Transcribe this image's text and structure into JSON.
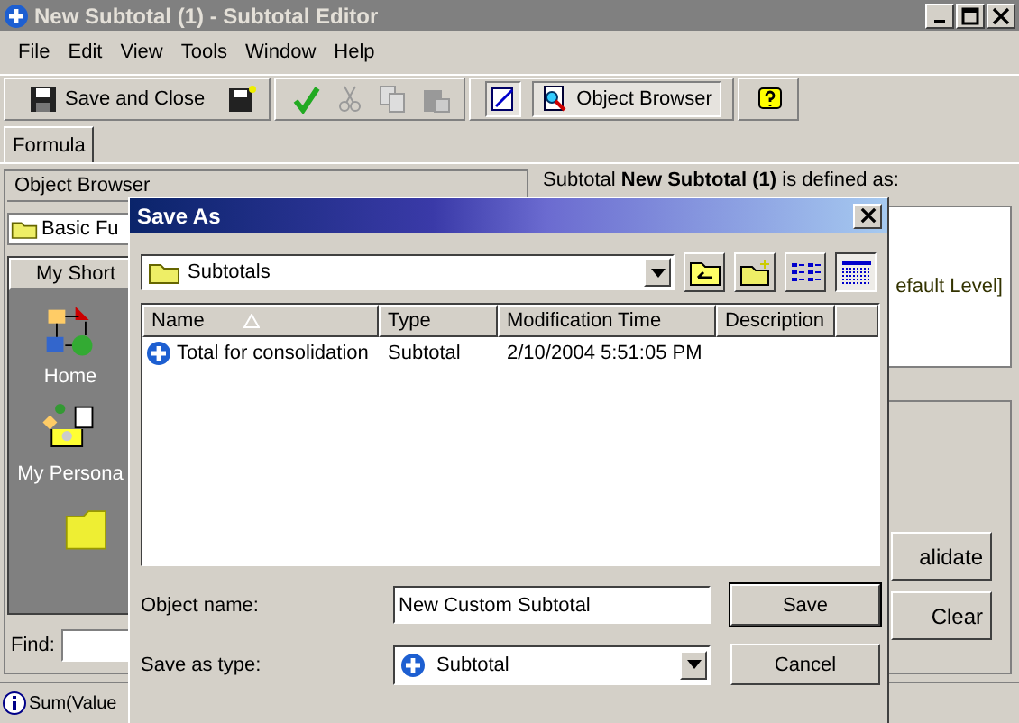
{
  "window": {
    "title": "New Subtotal (1) - Subtotal Editor"
  },
  "menu": [
    "File",
    "Edit",
    "View",
    "Tools",
    "Window",
    "Help"
  ],
  "toolbar": {
    "save_close": "Save and Close",
    "object_browser": {
      "label": "Object Browser",
      "selected": true
    }
  },
  "tabs": [
    {
      "label": "Formula",
      "selected": true
    }
  ],
  "left_panel": {
    "dropdown": "Object Browser",
    "category": "Basic Fu",
    "shortcuts_header": "My Short",
    "shortcuts": [
      {
        "kind": "home",
        "label": "Home"
      },
      {
        "kind": "personal",
        "label": "My Persona"
      },
      {
        "kind": "folder"
      }
    ],
    "find_label": "Find:"
  },
  "right_panel": {
    "definition": "Subtotal **New Subtotal (1)** is defined as:",
    "formula_fragment": "efault Level]",
    "buttons": [
      "alidate",
      "Clear"
    ]
  },
  "status_bar": {
    "text": "Sum(Value"
  },
  "dialog": {
    "title": "Save As",
    "folder": "Subtotals",
    "views": [
      {
        "kind": "list",
        "selected": false
      },
      {
        "kind": "details",
        "selected": true
      }
    ],
    "columns": [
      "Name",
      "Type",
      "Modification Time",
      "Description"
    ],
    "rows": [
      {
        "name": "Total for consolidation",
        "type": "Subtotal",
        "modified": "2/10/2004 5:51:05 PM",
        "selected": false
      }
    ],
    "object_name_label": "Object name:",
    "object_name": "New Custom Subtotal",
    "type_label": "Save as type:",
    "type_value": "Subtotal",
    "buttons": [
      "Save",
      "Cancel"
    ]
  }
}
